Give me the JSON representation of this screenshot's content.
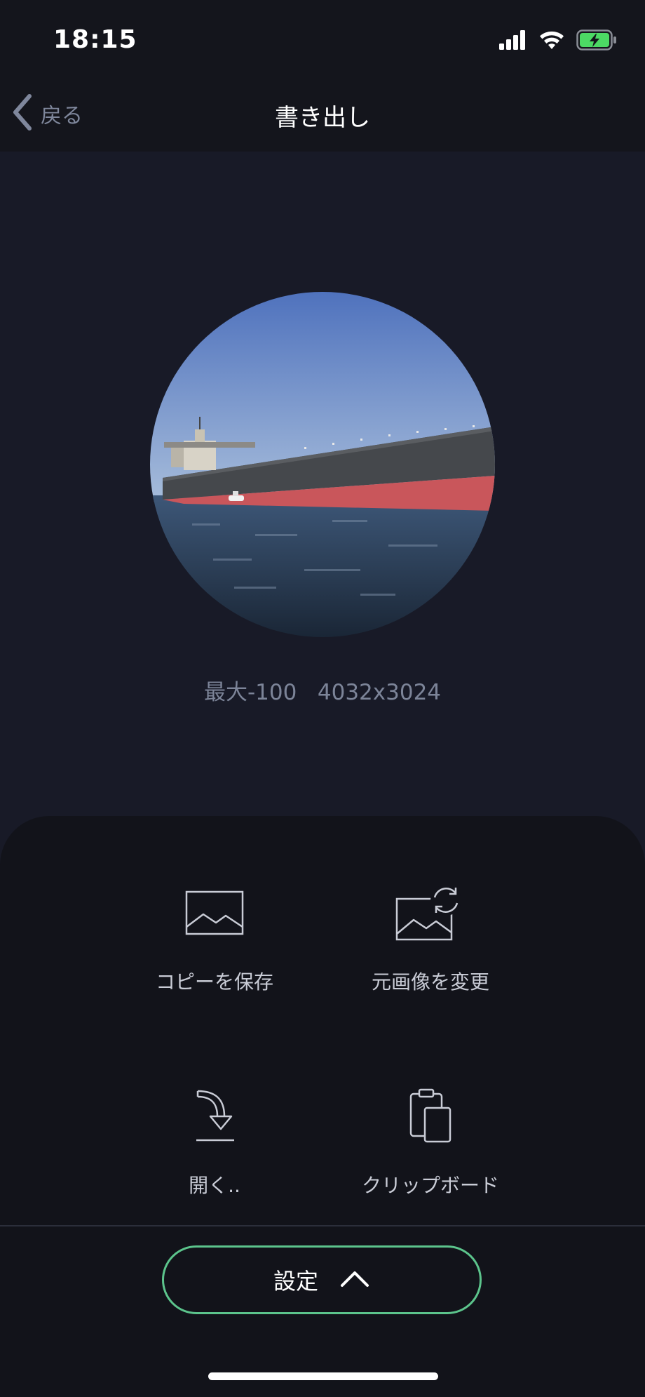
{
  "status_bar": {
    "time": "18:15",
    "icons": [
      "cellular-signal-icon",
      "wifi-icon",
      "battery-charging-icon"
    ]
  },
  "nav": {
    "back_label": "戻る",
    "title": "書き出し"
  },
  "preview": {
    "info": "最大-100   4032x3024"
  },
  "actions": [
    {
      "label": "コピーを保存",
      "icon": "image-icon"
    },
    {
      "label": "元画像を変更",
      "icon": "replace-image-icon"
    },
    {
      "label": "開く..",
      "icon": "open-in-icon"
    },
    {
      "label": "クリップボード",
      "icon": "clipboard-icon"
    }
  ],
  "footer": {
    "settings_label": "設定",
    "settings_icon": "chevron-up-icon"
  },
  "colors": {
    "accent": "#5cc48c",
    "background": "#181a27",
    "sheet": "#12131a",
    "battery": "#4cd964"
  }
}
